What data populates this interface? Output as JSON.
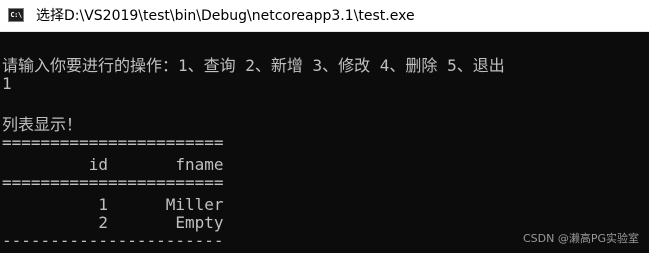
{
  "window": {
    "icon_text": "C:\\",
    "title": "选择D:\\VS2019\\test\\bin\\Debug\\netcoreapp3.1\\test.exe"
  },
  "console": {
    "lines": [
      "请输入你要进行的操作：1、查询 2、新增 3、修改 4、删除 5、退出",
      "1",
      "",
      "列表显示！",
      "=======================",
      "         id       fname",
      "=======================",
      "          1      Miller",
      "          2       Empty",
      "-----------------------"
    ]
  },
  "watermark": "CSDN @濑高PG实验室"
}
